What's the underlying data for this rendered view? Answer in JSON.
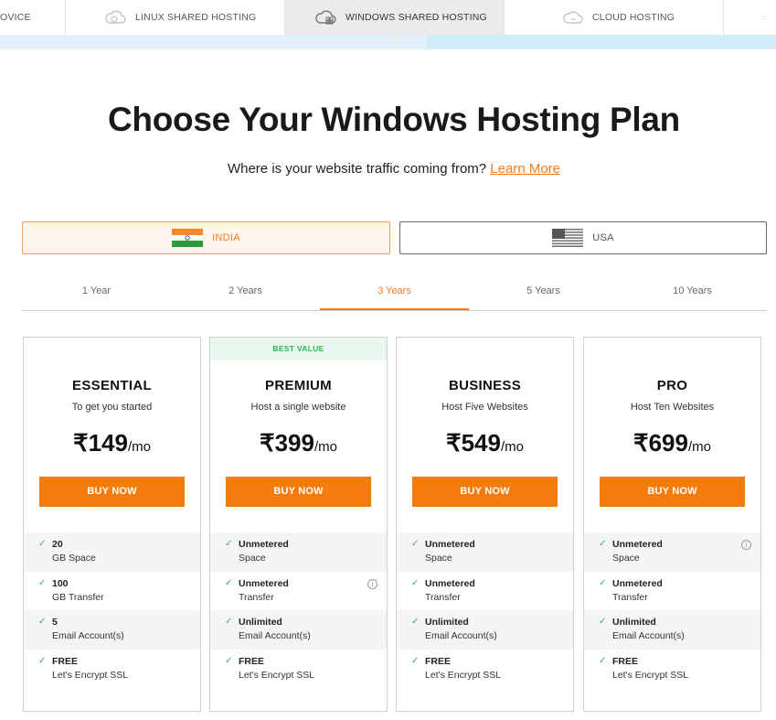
{
  "top_tabs": [
    {
      "label": "OVICE"
    },
    {
      "label": "LINUX SHARED HOSTING"
    },
    {
      "label": "WINDOWS SHARED HOSTING"
    },
    {
      "label": "CLOUD HOSTING"
    },
    {
      "label": ""
    }
  ],
  "heading": "Choose Your Windows Hosting Plan",
  "traffic_question": "Where is your website traffic coming from?",
  "learn_more": "Learn More",
  "countries": [
    {
      "label": "INDIA",
      "selected": true
    },
    {
      "label": "USA",
      "selected": false
    }
  ],
  "terms": [
    "1 Year",
    "2 Years",
    "3 Years",
    "5 Years",
    "10 Years"
  ],
  "active_term": "3 Years",
  "buy_label": "BUY NOW",
  "colors": {
    "accent": "#f57c0c",
    "check": "#2bb55a",
    "ribbon_bg": "#e9f8ee"
  },
  "plans": [
    {
      "ribbon": "",
      "name": "ESSENTIAL",
      "desc": "To get you started",
      "price": "₹149",
      "per": "/mo",
      "features": [
        {
          "l1": "20",
          "l2": "GB Space"
        },
        {
          "l1": "100",
          "l2": "GB Transfer"
        },
        {
          "l1": "5",
          "l2": "Email Account(s)"
        },
        {
          "l1": "FREE",
          "l2": "Let's Encrypt SSL"
        }
      ]
    },
    {
      "ribbon": "BEST VALUE",
      "name": "PREMIUM",
      "desc": "Host a single website",
      "price": "₹399",
      "per": "/mo",
      "features": [
        {
          "l1": "Unmetered",
          "l2": "Space"
        },
        {
          "l1": "Unmetered",
          "l2": "Transfer"
        },
        {
          "l1": "Unlimited",
          "l2": "Email Account(s)"
        },
        {
          "l1": "FREE",
          "l2": "Let's Encrypt SSL"
        }
      ]
    },
    {
      "ribbon": "",
      "name": "BUSINESS",
      "desc": "Host Five Websites",
      "price": "₹549",
      "per": "/mo",
      "features": [
        {
          "l1": "Unmetered",
          "l2": "Space"
        },
        {
          "l1": "Unmetered",
          "l2": "Transfer"
        },
        {
          "l1": "Unlimited",
          "l2": "Email Account(s)"
        },
        {
          "l1": "FREE",
          "l2": "Let's Encrypt SSL"
        }
      ]
    },
    {
      "ribbon": "",
      "name": "PRO",
      "desc": "Host Ten Websites",
      "price": "₹699",
      "per": "/mo",
      "features": [
        {
          "l1": "Unmetered",
          "l2": "Space"
        },
        {
          "l1": "Unmetered",
          "l2": "Transfer"
        },
        {
          "l1": "Unlimited",
          "l2": "Email Account(s)"
        },
        {
          "l1": "FREE",
          "l2": "Let's Encrypt SSL"
        }
      ]
    }
  ]
}
